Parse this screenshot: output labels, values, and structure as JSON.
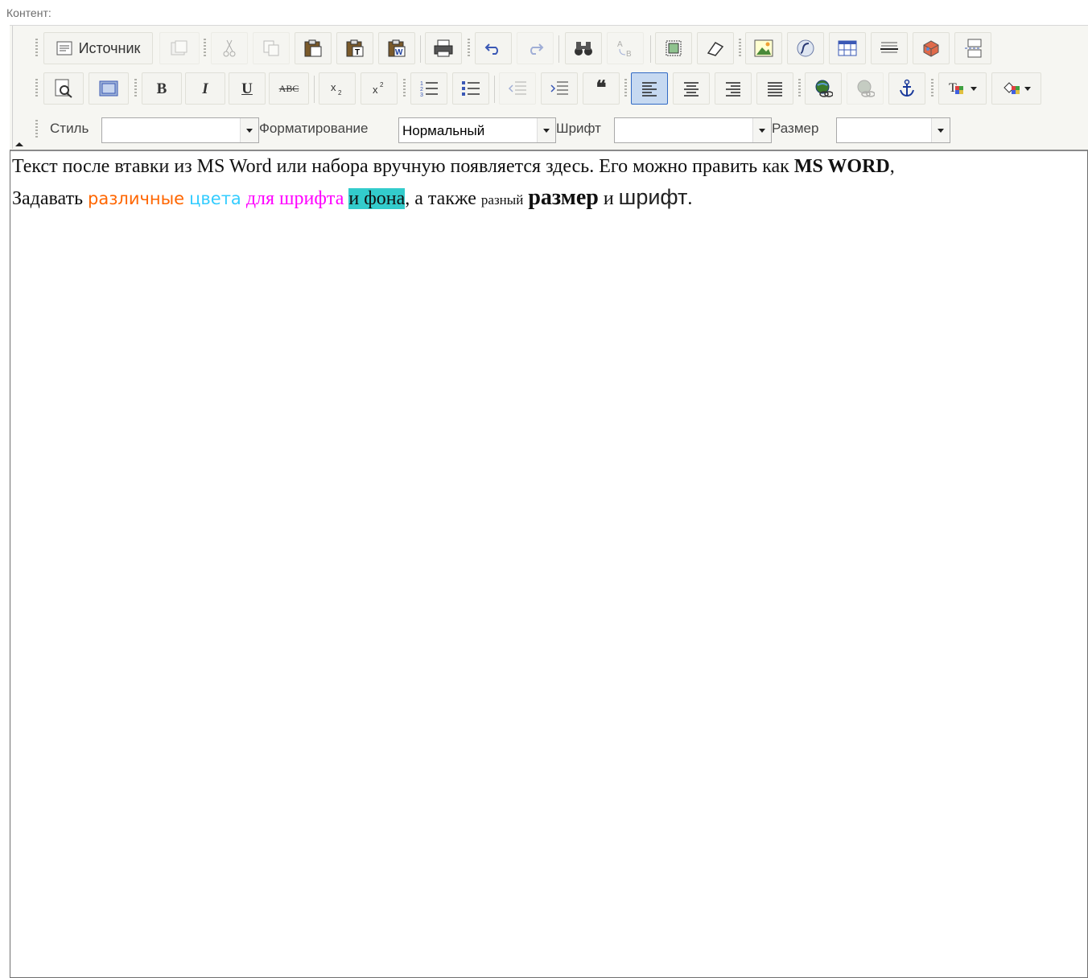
{
  "field_label": "Контент:",
  "toolbar": {
    "source_label": "Источник",
    "combos": {
      "style": {
        "label": "Стиль",
        "value": ""
      },
      "format": {
        "label": "Форматирование",
        "value": "Нормальный"
      },
      "font": {
        "label": "Шрифт",
        "value": ""
      },
      "size": {
        "label": "Размер",
        "value": ""
      }
    },
    "glyphs": {
      "bold": "B",
      "italic": "I",
      "underline": "U",
      "strike": "ABC",
      "quote": "❝"
    }
  },
  "content": {
    "line1": {
      "plain": "Текст после втавки из MS Word или набора вручную появляется здесь. Его можно править как ",
      "bold": "MS WORD",
      "end": ","
    },
    "line2": {
      "p1": "Задавать ",
      "orange": "различные",
      "space1": " ",
      "cyan": "цвета",
      "space2": " ",
      "magenta": "для шрифта",
      "space3": " ",
      "highlight": "и фона",
      "p2": ", а также ",
      "small": "разный",
      "space4": " ",
      "bigbold": "размер",
      "p3": " и ",
      "sans": "шрифт",
      "end": "."
    }
  },
  "colors": {
    "orange": "#ff6600",
    "cyan": "#33ccff",
    "magenta": "#ff00ff",
    "highlight_bg": "#33cccc",
    "active_button": "#c6d9f1"
  }
}
